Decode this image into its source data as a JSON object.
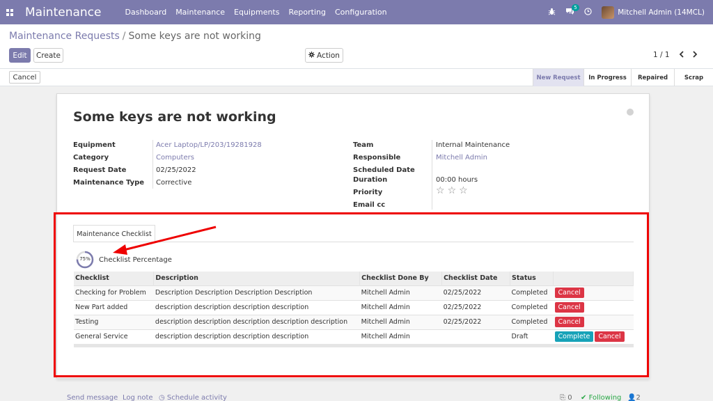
{
  "navbar": {
    "brand": "Maintenance",
    "menu": [
      "Dashboard",
      "Maintenance",
      "Equipments",
      "Reporting",
      "Configuration"
    ],
    "chat_count": "5",
    "user": "Mitchell Admin (14MCL)"
  },
  "breadcrumb": {
    "parent": "Maintenance Requests",
    "separator": "/",
    "current": "Some keys are not working"
  },
  "buttons": {
    "edit": "Edit",
    "create": "Create",
    "action": "Action",
    "cancel": "Cancel"
  },
  "pager": {
    "value": "1 / 1"
  },
  "stages": [
    {
      "label": "New Request",
      "active": true
    },
    {
      "label": "In Progress",
      "active": false
    },
    {
      "label": "Repaired",
      "active": false
    },
    {
      "label": "Scrap",
      "active": false
    }
  ],
  "record": {
    "title": "Some keys are not working",
    "left_fields": [
      {
        "label": "Equipment",
        "value": "Acer Laptop/LP/203/19281928",
        "link": true
      },
      {
        "label": "Category",
        "value": "Computers",
        "link": true
      },
      {
        "label": "Request Date",
        "value": "02/25/2022",
        "link": false
      },
      {
        "label": "Maintenance Type",
        "value": "Corrective",
        "link": false
      }
    ],
    "right_fields": [
      {
        "label": "Team",
        "value": "Internal Maintenance",
        "link": false
      },
      {
        "label": "Responsible",
        "value": "Mitchell Admin",
        "link": true
      },
      {
        "label": "Scheduled Date",
        "value": "",
        "link": false
      },
      {
        "label": "Duration",
        "value": "00:00  hours",
        "link": false
      },
      {
        "label": "Priority",
        "value": "",
        "link": false
      },
      {
        "label": "Email cc",
        "value": "",
        "link": false
      }
    ],
    "priority_stars": 0
  },
  "checklist_tab": {
    "label": "Maintenance Checklist",
    "progress_percent": 75,
    "progress_text": "75%",
    "progress_label": "Checklist Percentage",
    "columns": [
      "Checklist",
      "Description",
      "Checklist Done By",
      "Checklist Date",
      "Status",
      ""
    ],
    "rows": [
      {
        "checklist": "Checking for Problem",
        "description": "Description Description Description Description",
        "done_by": "Mitchell Admin",
        "date": "02/25/2022",
        "status": "Completed",
        "actions": [
          "Cancel"
        ]
      },
      {
        "checklist": "New Part added",
        "description": "description description description description",
        "done_by": "Mitchell Admin",
        "date": "02/25/2022",
        "status": "Completed",
        "actions": [
          "Cancel"
        ]
      },
      {
        "checklist": "Testing",
        "description": "description description description description description",
        "done_by": "Mitchell Admin",
        "date": "02/25/2022",
        "status": "Completed",
        "actions": [
          "Cancel"
        ]
      },
      {
        "checklist": "General Service",
        "description": "description description description description",
        "done_by": "Mitchell Admin",
        "date": "",
        "status": "Draft",
        "actions": [
          "Complete",
          "Cancel"
        ]
      }
    ]
  },
  "chatter": {
    "send_message": "Send message",
    "log_note": "Log note",
    "schedule_activity": "Schedule activity",
    "attachments": "0",
    "following": "Following",
    "followers": "2"
  },
  "colors": {
    "brand": "#7c7bad",
    "danger": "#dc3545",
    "info": "#17a2b8",
    "annotation": "#ee0000"
  }
}
